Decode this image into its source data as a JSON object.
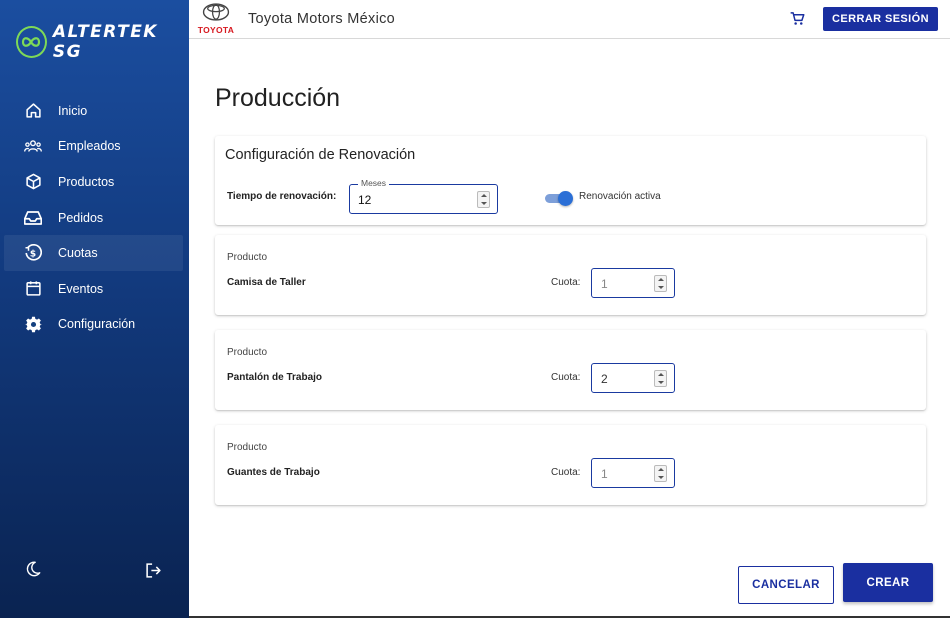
{
  "brand": {
    "name": "ALTERTEK SG",
    "logo_color": "#7ed957"
  },
  "sidebar": {
    "items": [
      {
        "label": "Inicio",
        "icon": "home-icon"
      },
      {
        "label": "Empleados",
        "icon": "people-icon"
      },
      {
        "label": "Productos",
        "icon": "box-icon"
      },
      {
        "label": "Pedidos",
        "icon": "inbox-icon"
      },
      {
        "label": "Cuotas",
        "icon": "money-icon",
        "active": true
      },
      {
        "label": "Eventos",
        "icon": "calendar-icon"
      },
      {
        "label": "Configuración",
        "icon": "gear-icon"
      }
    ],
    "bottom": {
      "theme_icon": "moon-icon",
      "logout_icon": "logout-icon"
    }
  },
  "header": {
    "logo_word": "TOYOTA",
    "company": "Toyota Motors México",
    "cart_icon": "cart-icon",
    "logout_label": "CERRAR SESIÓN"
  },
  "main": {
    "title": "Producción",
    "config": {
      "title": "Configuración de Renovación",
      "renewal_label": "Tiempo de renovación:",
      "months_legend": "Meses",
      "months_value": "12",
      "switch_label": "Renovación activa",
      "switch_on": true
    },
    "products": [
      {
        "caption": "Producto",
        "name": "Camisa de Taller",
        "quota_label": "Cuota:",
        "quota": "1"
      },
      {
        "caption": "Producto",
        "name": "Pantalón de Trabajo",
        "quota_label": "Cuota:",
        "quota": "2"
      },
      {
        "caption": "Producto",
        "name": "Guantes de Trabajo",
        "quota_label": "Cuota:",
        "quota": "1"
      }
    ]
  },
  "footer": {
    "cancel_label": "CANCELAR",
    "create_label": "CREAR"
  },
  "colors": {
    "primary": "#1a2fa0",
    "sidebar_top": "#1b4ea0",
    "sidebar_bottom": "#0a2351",
    "toyota_red": "#d71920"
  }
}
